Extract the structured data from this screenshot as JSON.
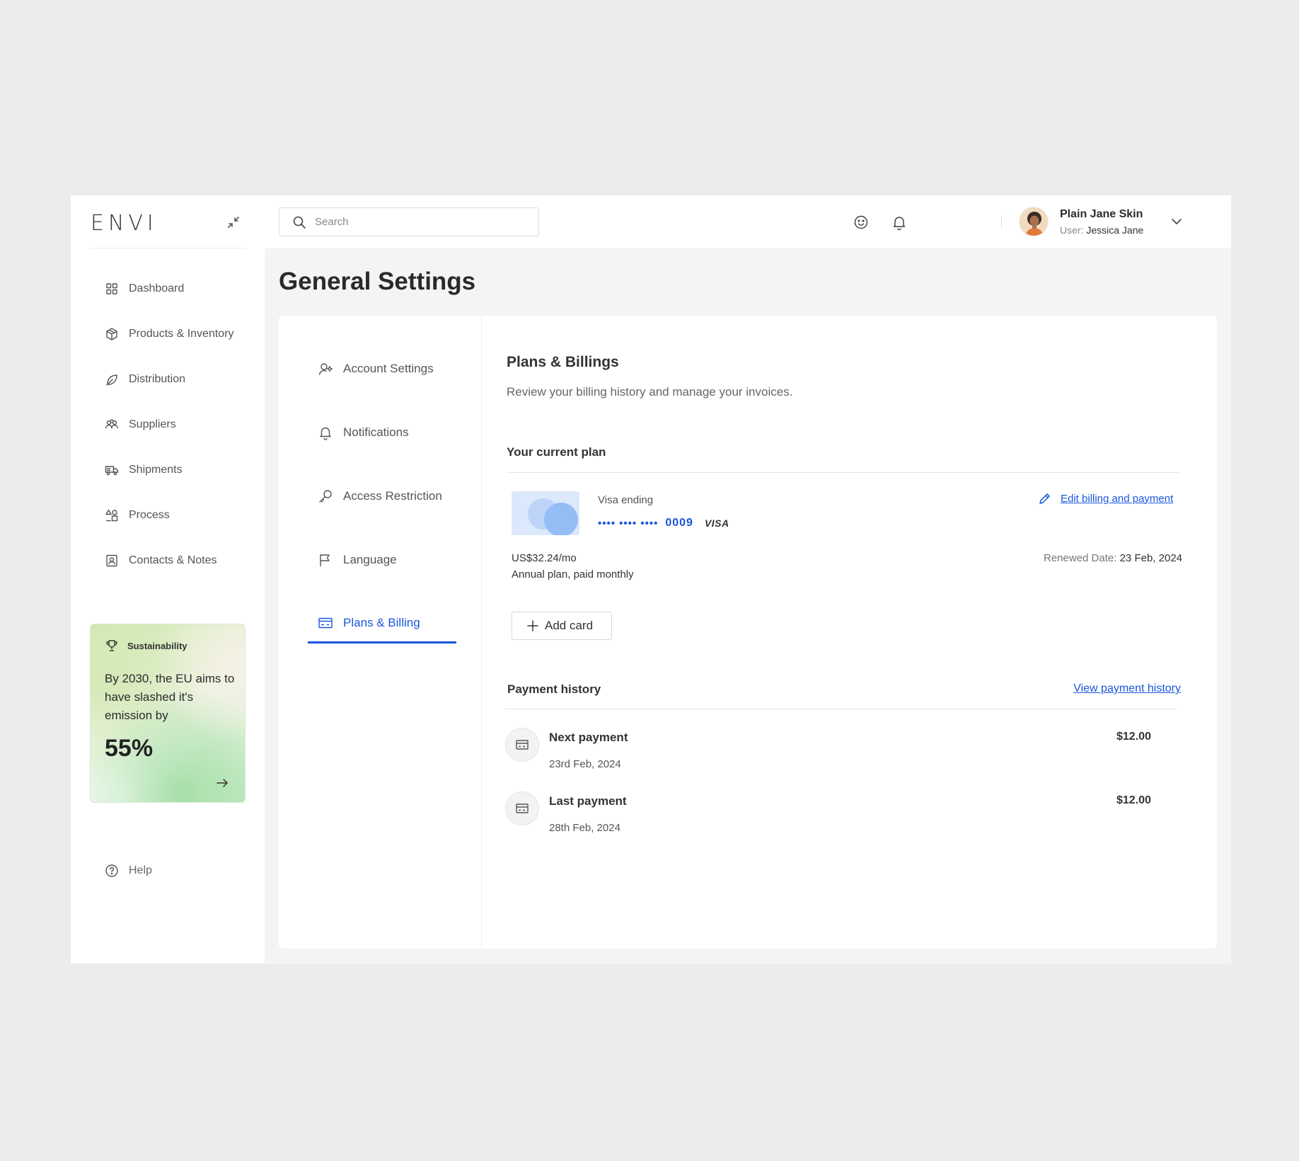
{
  "sidebar": {
    "logo": "ENVI",
    "items": [
      {
        "label": "Dashboard",
        "icon": "grid-icon"
      },
      {
        "label": "Products & Inventory",
        "icon": "box-icon"
      },
      {
        "label": "Distribution",
        "icon": "leaf-icon"
      },
      {
        "label": "Suppliers",
        "icon": "users-icon"
      },
      {
        "label": "Shipments",
        "icon": "truck-icon"
      },
      {
        "label": "Process",
        "icon": "shapes-icon"
      },
      {
        "label": "Contacts & Notes",
        "icon": "contact-icon"
      }
    ],
    "promo": {
      "title": "Sustainability",
      "text": "By 2030, the EU aims to have slashed it's emission by",
      "value": "55%"
    },
    "help": "Help"
  },
  "topbar": {
    "search_placeholder": "Search",
    "user_name": "Plain Jane Skin",
    "user_role_label": "User:",
    "user_role_value": "Jessica Jane"
  },
  "page_title": "General Settings",
  "settings_nav": [
    {
      "label": "Account Settings",
      "icon": "user-gear-icon"
    },
    {
      "label": "Notifications",
      "icon": "bell-icon"
    },
    {
      "label": "Access Restriction",
      "icon": "key-icon"
    },
    {
      "label": "Language",
      "icon": "flag-icon"
    },
    {
      "label": "Plans & Billing",
      "icon": "credit-card-icon",
      "active": true
    }
  ],
  "billing": {
    "title": "Plans & Billings",
    "subtitle": "Review your billing history and manage your invoices.",
    "current_plan_heading": "Your current plan",
    "card_label": "Visa ending",
    "card_mask": "•••• •••• ••••",
    "card_last4": "0009",
    "card_brand": "VISA",
    "edit_link": "Edit billing and payment",
    "price": "US$32.24/mo",
    "plan_desc": "Annual plan, paid monthly",
    "renewed_label": "Renewed Date:",
    "renewed_value": "23 Feb, 2024",
    "add_card": "Add card",
    "history_heading": "Payment history",
    "history_link": "View payment history",
    "payments": [
      {
        "title": "Next payment",
        "date": "23rd Feb, 2024",
        "amount": "$12.00"
      },
      {
        "title": "Last payment",
        "date": "28th Feb, 2024",
        "amount": "$12.00"
      }
    ]
  },
  "colors": {
    "accent": "#1a56db",
    "promo_green": "#a6dfa9"
  }
}
